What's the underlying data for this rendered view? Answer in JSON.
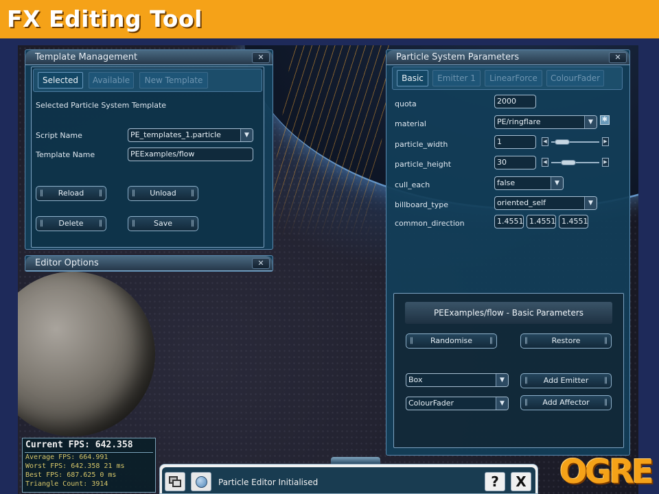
{
  "slide_title": "FX Editing Tool",
  "template_management": {
    "title": "Template Management",
    "tabs": [
      "Selected",
      "Available",
      "New Template"
    ],
    "active_tab": "Selected",
    "section_label": "Selected Particle System Template",
    "script_name_label": "Script Name",
    "script_name_value": "PE_templates_1.particle",
    "template_name_label": "Template Name",
    "template_name_value": "PEExamples/flow",
    "buttons": {
      "reload": "Reload",
      "unload": "Unload",
      "delete": "Delete",
      "save": "Save"
    }
  },
  "editor_options": {
    "title": "Editor Options"
  },
  "particle_params": {
    "title": "Particle System Parameters",
    "tabs": [
      "Basic",
      "Emitter 1",
      "LinearForce",
      "ColourFader"
    ],
    "active_tab": "Basic",
    "rows": {
      "quota": {
        "label": "quota",
        "value": "2000"
      },
      "material": {
        "label": "material",
        "value": "PE/ringflare"
      },
      "particle_width": {
        "label": "particle_width",
        "value": "1",
        "slider_fraction": 0.1
      },
      "particle_height": {
        "label": "particle_height",
        "value": "30",
        "slider_fraction": 0.3
      },
      "cull_each": {
        "label": "cull_each",
        "value": "false"
      },
      "billboard_type": {
        "label": "billboard_type",
        "value": "oriented_self"
      },
      "common_direction": {
        "label": "common_direction",
        "values": [
          "1.45513",
          "1.45513",
          "1.45513"
        ]
      }
    },
    "basic_parameters": {
      "title": "PEExamples/flow - Basic Parameters",
      "randomise": "Randomise",
      "restore": "Restore",
      "emitter_type": "Box",
      "add_emitter": "Add Emitter",
      "affector_type": "ColourFader",
      "add_affector": "Add Affector"
    }
  },
  "fps": {
    "current": "Current FPS: 642.358",
    "average": "Average FPS: 664.991",
    "worst": "Worst FPS: 642.358 21 ms",
    "best": "Best FPS: 687.625 0 ms",
    "triangles": "Triangle Count: 3914"
  },
  "statusbar": {
    "message": "Particle Editor Initialised",
    "help": "?",
    "close": "X"
  },
  "logo_text": "OGRE",
  "colors": {
    "title_bar": "#f5a218",
    "panel": "#123e58",
    "accent_border": "#5a8ab0"
  }
}
